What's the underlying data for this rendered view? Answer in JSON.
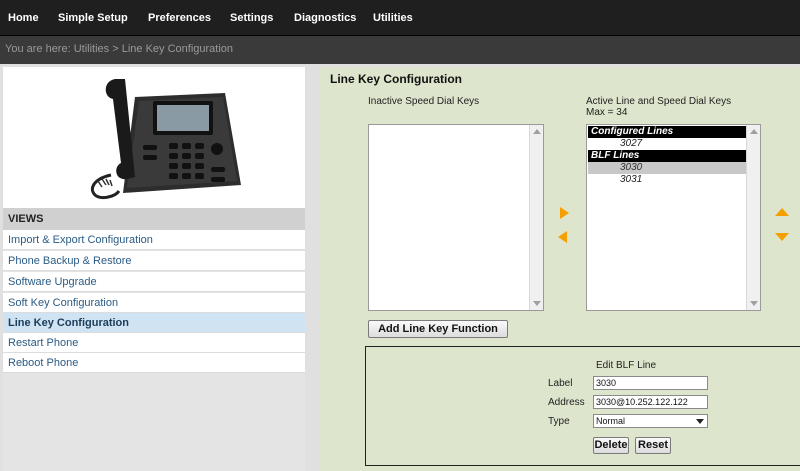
{
  "nav": {
    "items": [
      "Home",
      "Simple Setup",
      "Preferences",
      "Settings",
      "Diagnostics",
      "Utilities"
    ]
  },
  "breadcrumb": {
    "prefix": "You are here:",
    "section": "Utilities",
    "separator": ">",
    "page": "Line Key Configuration"
  },
  "sidebar": {
    "phone_image": "desk-phone-image",
    "views_header": "VIEWS",
    "items": [
      "Import & Export Configuration",
      "Phone Backup & Restore",
      "Software Upgrade",
      "Soft Key Configuration",
      "Line Key Configuration",
      "Restart Phone",
      "Reboot Phone"
    ],
    "active_index": 4
  },
  "main": {
    "title": "Line Key Configuration",
    "inactive_label": "Inactive Speed Dial Keys",
    "active_label": "Active Line and Speed Dial Keys",
    "active_max": "Max = 34",
    "active_list": {
      "configured_header": "Configured Lines",
      "configured_items": [
        "3027"
      ],
      "blf_header": "BLF Lines",
      "blf_items": [
        "3030",
        "3031"
      ],
      "selected": "3030"
    },
    "add_button": "Add Line Key Function",
    "edit": {
      "title": "Edit BLF Line",
      "label_label": "Label",
      "label_value": "3030",
      "address_label": "Address",
      "address_value": "3030@10.252.122.122",
      "type_label": "Type",
      "type_value": "Normal",
      "delete_button": "Delete",
      "reset_button": "Reset"
    }
  },
  "colors": {
    "nav_bg": "#1f1f1f",
    "panel_bg": "#dde5cd",
    "arrow": "#f5a000",
    "active_item_bg": "#cfe3f3",
    "link": "#2a5b85"
  }
}
